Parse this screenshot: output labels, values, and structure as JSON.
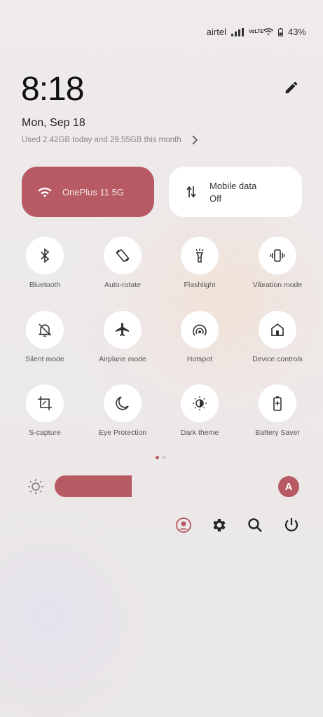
{
  "status": {
    "carrier": "airtel",
    "net_label": "VoLTE",
    "battery": "43%"
  },
  "header": {
    "time": "8:18",
    "date": "Mon, Sep 18",
    "usage": "Used 2.42GB today and 29.55GB this month"
  },
  "big_tiles": {
    "wifi": {
      "label": "OnePlus 11 5G"
    },
    "mobile_data": {
      "title": "Mobile data",
      "state": "Off"
    }
  },
  "tiles": [
    {
      "label": "Bluetooth",
      "icon": "bluetooth-icon"
    },
    {
      "label": "Auto-rotate",
      "icon": "auto-rotate-icon"
    },
    {
      "label": "Flashlight",
      "icon": "flashlight-icon"
    },
    {
      "label": "Vibration mode",
      "icon": "vibration-icon"
    },
    {
      "label": "Silent mode",
      "icon": "silent-icon"
    },
    {
      "label": "Airplane mode",
      "icon": "airplane-icon"
    },
    {
      "label": "Hotspot",
      "icon": "hotspot-icon"
    },
    {
      "label": "Device controls",
      "icon": "home-icon"
    },
    {
      "label": "S-capture",
      "icon": "crop-icon"
    },
    {
      "label": "Eye Protection",
      "icon": "moon-icon"
    },
    {
      "label": "Dark theme",
      "icon": "contrast-icon"
    },
    {
      "label": "Battery Saver",
      "icon": "battery-icon"
    }
  ],
  "brightness": {
    "level": 0.36,
    "auto_label": "A"
  },
  "colors": {
    "accent": "#b75a63",
    "tile_bg": "#ffffff",
    "page_bg": "#ece9e9"
  }
}
